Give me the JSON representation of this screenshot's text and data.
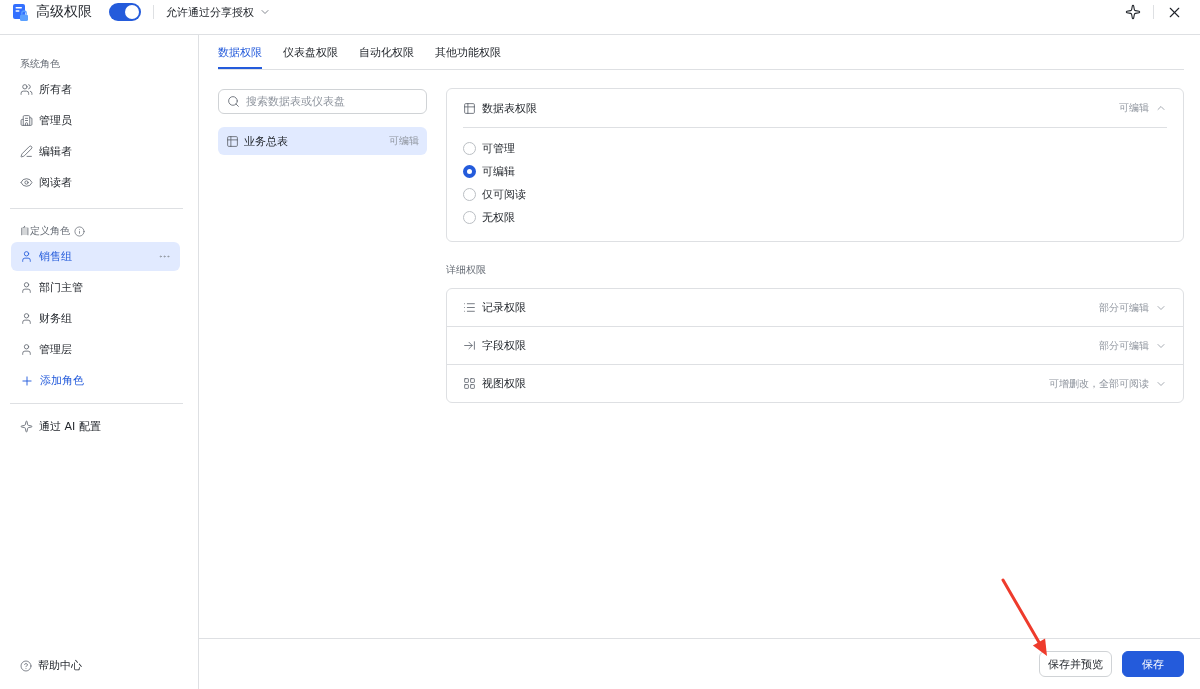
{
  "header": {
    "title": "高级权限",
    "enabled": true,
    "share_option": "允许通过分享授权"
  },
  "sidebar": {
    "system_roles": {
      "label": "系统角色",
      "items": [
        {
          "label": "所有者",
          "selected": false
        },
        {
          "label": "管理员",
          "selected": false
        },
        {
          "label": "编辑者",
          "selected": false
        },
        {
          "label": "阅读者",
          "selected": false
        }
      ]
    },
    "custom_roles": {
      "label": "自定义角色",
      "items": [
        {
          "label": "销售组",
          "selected": true
        },
        {
          "label": "部门主管",
          "selected": false
        },
        {
          "label": "财务组",
          "selected": false
        },
        {
          "label": "管理层",
          "selected": false
        }
      ],
      "add_button": "添加角色"
    },
    "ai_config": "通过 AI 配置",
    "help": "帮助中心"
  },
  "tabs": [
    {
      "label": "数据权限",
      "selected": true
    },
    {
      "label": "仪表盘权限",
      "selected": false
    },
    {
      "label": "自动化权限",
      "selected": false
    },
    {
      "label": "其他功能权限",
      "selected": false
    }
  ],
  "search": {
    "placeholder": "搜索数据表或仪表盘"
  },
  "resources": [
    {
      "name": "业务总表",
      "permission": "可编辑",
      "selected": true
    }
  ],
  "table_permission": {
    "title": "数据表权限",
    "summary": "可编辑",
    "expanded": true,
    "options": [
      {
        "label": "可管理",
        "selected": false
      },
      {
        "label": "可编辑",
        "selected": true
      },
      {
        "label": "仅可阅读",
        "selected": false
      },
      {
        "label": "无权限",
        "selected": false
      }
    ]
  },
  "detail_permissions": {
    "label": "详细权限",
    "rows": [
      {
        "title": "记录权限",
        "summary": "部分可编辑",
        "expanded": false
      },
      {
        "title": "字段权限",
        "summary": "部分可编辑",
        "expanded": false
      },
      {
        "title": "视图权限",
        "summary": "可增删改，全部可阅读",
        "expanded": false
      }
    ]
  },
  "footer": {
    "buttons": [
      {
        "label": "保存并预览",
        "kind": "secondary"
      },
      {
        "label": "保存",
        "kind": "primary"
      }
    ]
  }
}
